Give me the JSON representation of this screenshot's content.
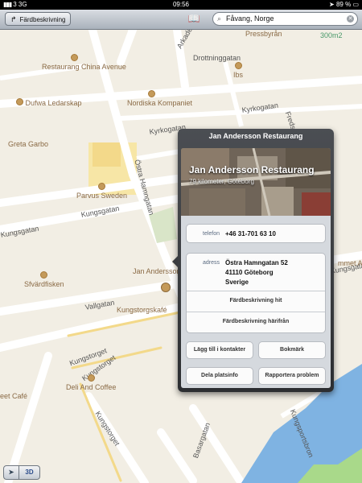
{
  "status_bar": {
    "carrier": "3",
    "network": "3G",
    "time": "09:56",
    "battery": "89 %",
    "signal_bars": "▮▮▮"
  },
  "toolbar": {
    "directions_label": "Färdbeskrivning",
    "search_value": "Fåvang, Norge"
  },
  "map": {
    "streets": [
      "Drottninggatan",
      "Kyrkogatan",
      "Kyrkogatan",
      "Östra Hamngatan",
      "Kungsgatan",
      "Kungsgatan",
      "Vallgatan",
      "Kungstorget",
      "Kungstorget",
      "Kungstorget",
      "Kungsportsbron",
      "Basargatan",
      "Kungsgatan",
      "Arkaden",
      "Fredsg"
    ],
    "pois": [
      "Restaurang China Avenue",
      "Dufwa Ledarskap",
      "Greta Garbo",
      "Nordiska Kompaniet",
      "Ibs",
      "Pressbyrån",
      "Parvus Sweden",
      "Sfvärdfisken",
      "Kungstorgskafé",
      "Deli And Coffee",
      "eet Café",
      "Jan Andersson Restaurang",
      "mmet A",
      "300m2"
    ]
  },
  "popover": {
    "title": "Jan Andersson Restaurang",
    "name": "Jan Andersson Restaurang",
    "distance": "79 kilometer, Göteborg",
    "phone_label": "telefon",
    "phone": "+46 31-701 63 10",
    "address_label": "adress",
    "address_line1": "Östra Hamngatan 52",
    "address_line2": "41110 Göteborg",
    "address_line3": "Sverige",
    "directions_here": "Färdbeskrivning hit",
    "directions_from": "Färdbeskrivning härifrån",
    "add_contact": "Lägg till i kontakter",
    "bookmark": "Bokmärk",
    "share": "Dela platsinfo",
    "report": "Rapportera problem"
  },
  "controls": {
    "three_d": "3D"
  }
}
